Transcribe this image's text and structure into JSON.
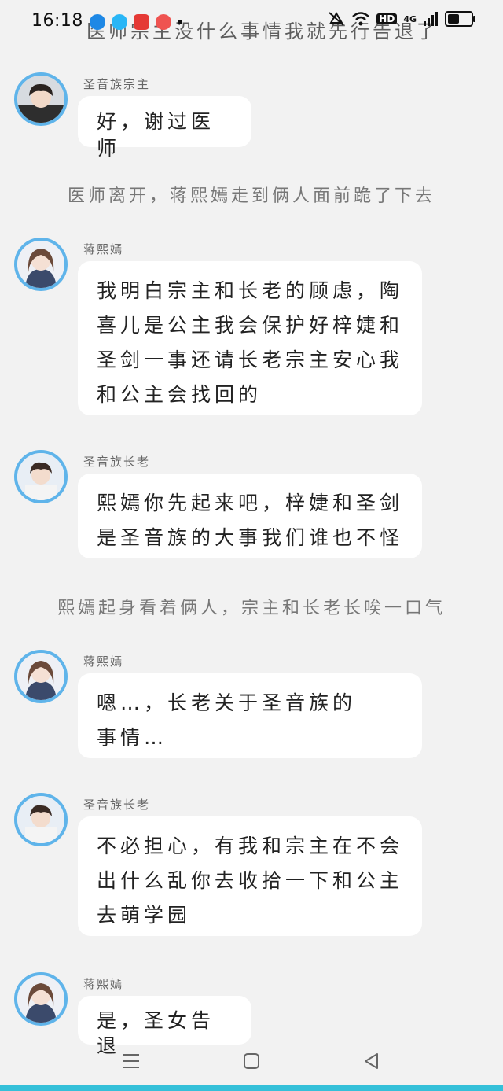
{
  "status_bar": {
    "time": "16:18",
    "overlap_text": "医师宗主没什么事情我就先行告退了",
    "network": "4G",
    "hd": "HD"
  },
  "messages": [
    {
      "type": "chat",
      "sender": "圣音族宗主",
      "text": "好，谢过医师",
      "avatar": "male-a"
    },
    {
      "type": "narration",
      "text": "医师离开，蒋熙嫣走到俩人面前跪了下去"
    },
    {
      "type": "chat",
      "sender": "蒋熙嫣",
      "text": "我明白宗主和长老的顾虑，陶喜儿是公主我会保护好梓婕和圣剑一事还请长老宗主安心我和公主会找回的",
      "avatar": "female"
    },
    {
      "type": "chat",
      "sender": "圣音族长老",
      "text": "熙嫣你先起来吧，梓婕和圣剑是圣音族的大事我们谁也不怪",
      "avatar": "male-b"
    },
    {
      "type": "narration",
      "text": "熙嫣起身看着俩人，宗主和长老长唉一口气"
    },
    {
      "type": "chat",
      "sender": "蒋熙嫣",
      "text": "嗯…，长老关于圣音族的事情…",
      "avatar": "female"
    },
    {
      "type": "chat",
      "sender": "圣音族长老",
      "text": "不必担心，有我和宗主在不会出什么乱你去收拾一下和公主去萌学园",
      "avatar": "male-b"
    },
    {
      "type": "chat",
      "sender": "蒋熙嫣",
      "text": "是，圣女告退",
      "avatar": "female"
    }
  ],
  "nav": {
    "menu_icon": "menu-icon",
    "home_icon": "home-square-icon",
    "back_icon": "back-triangle-icon"
  },
  "colors": {
    "background": "#f2f2f2",
    "avatar_ring": "#5fb4ea",
    "bubble": "#ffffff",
    "accent_line": "#35c0d9"
  }
}
